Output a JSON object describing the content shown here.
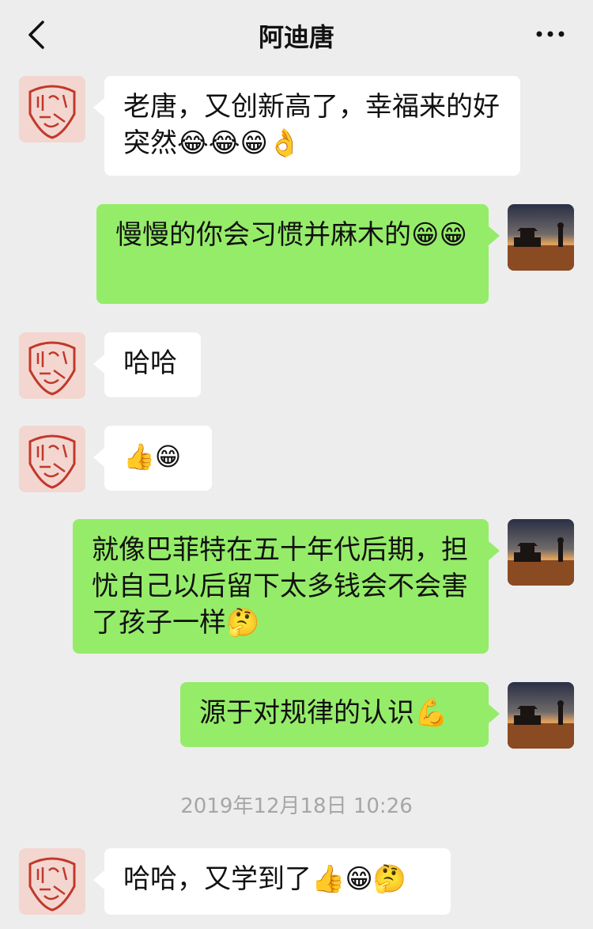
{
  "header": {
    "title": "阿迪唐"
  },
  "messages": [
    {
      "from": "contact",
      "text": "老唐，又创新高了，幸福来的好突然😂😂😁👌"
    },
    {
      "from": "me",
      "text": "慢慢的你会习惯并麻木的😁😁"
    },
    {
      "from": "contact",
      "text": "哈哈"
    },
    {
      "from": "contact",
      "text": "👍😁"
    },
    {
      "from": "me",
      "text": "就像巴菲特在五十年代后期，担忧自己以后留下太多钱会不会害了孩子一样🤔"
    },
    {
      "from": "me",
      "text": "源于对规律的认识💪"
    },
    {
      "from": "contact",
      "text": "哈哈，又学到了👍😁🤔"
    }
  ],
  "timestamp": "2019年12月18日 10:26",
  "colors": {
    "background": "#ededed",
    "incoming_bubble": "#ffffff",
    "outgoing_bubble": "#95ec69",
    "timestamp_text": "#a6a6a6"
  },
  "icons": {
    "back": "chevron-left-icon",
    "more": "more-dots-icon",
    "contact_avatar": "red-seal-avatar",
    "my_avatar": "sunset-silhouette-avatar"
  }
}
